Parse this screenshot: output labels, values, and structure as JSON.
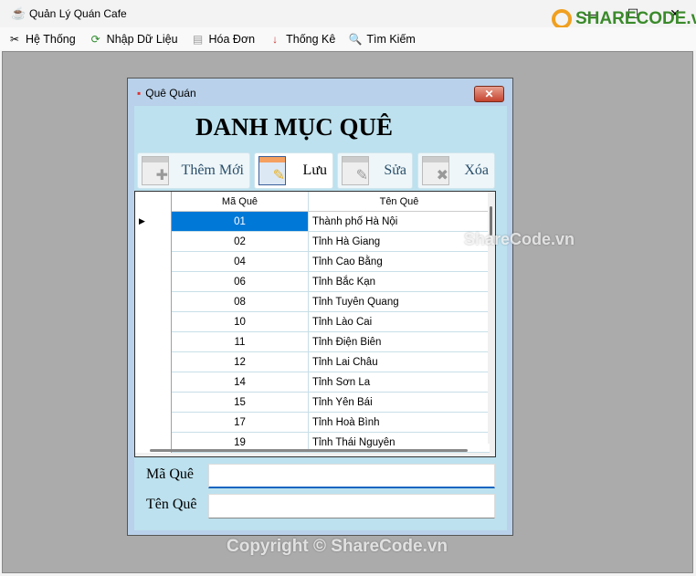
{
  "app": {
    "title": "Quản Lý Quán Cafe",
    "icon": "coffee-cup-icon"
  },
  "menu": [
    {
      "label": "Hệ Thống",
      "icon": "tools-icon"
    },
    {
      "label": "Nhập Dữ Liệu",
      "icon": "refresh-icon"
    },
    {
      "label": "Hóa Đơn",
      "icon": "invoice-icon"
    },
    {
      "label": "Thống Kê",
      "icon": "sort-az-icon"
    },
    {
      "label": "Tìm Kiếm",
      "icon": "search-icon"
    }
  ],
  "dialog": {
    "title": "Quê Quán",
    "heading": "DANH MỤC QUÊ",
    "buttons": {
      "add": "Thêm Mới",
      "save": "Lưu",
      "edit": "Sửa",
      "delete": "Xóa"
    },
    "grid": {
      "columns": [
        "Mã Quê",
        "Tên Quê"
      ],
      "selected_row": 0,
      "rows": [
        [
          "01",
          "Thành phố Hà Nội"
        ],
        [
          "02",
          "Tỉnh Hà Giang"
        ],
        [
          "04",
          "Tỉnh Cao Bằng"
        ],
        [
          "06",
          "Tỉnh Bắc Kạn"
        ],
        [
          "08",
          "Tỉnh Tuyên Quang"
        ],
        [
          "10",
          "Tỉnh Lào Cai"
        ],
        [
          "11",
          "Tỉnh Điện Biên"
        ],
        [
          "12",
          "Tỉnh Lai Châu"
        ],
        [
          "14",
          "Tỉnh Sơn La"
        ],
        [
          "15",
          "Tỉnh Yên Bái"
        ],
        [
          "17",
          "Tỉnh Hoà Bình"
        ],
        [
          "19",
          "Tỉnh Thái Nguyên"
        ]
      ]
    },
    "form": {
      "ma_que_label": "Mã Quê",
      "ma_que_value": "",
      "ten_que_label": "Tên Quê",
      "ten_que_value": ""
    }
  },
  "watermark": {
    "logo": "SHARECODE.vn",
    "center": "ShareCode.vn",
    "footer": "Copyright © ShareCode.vn"
  }
}
